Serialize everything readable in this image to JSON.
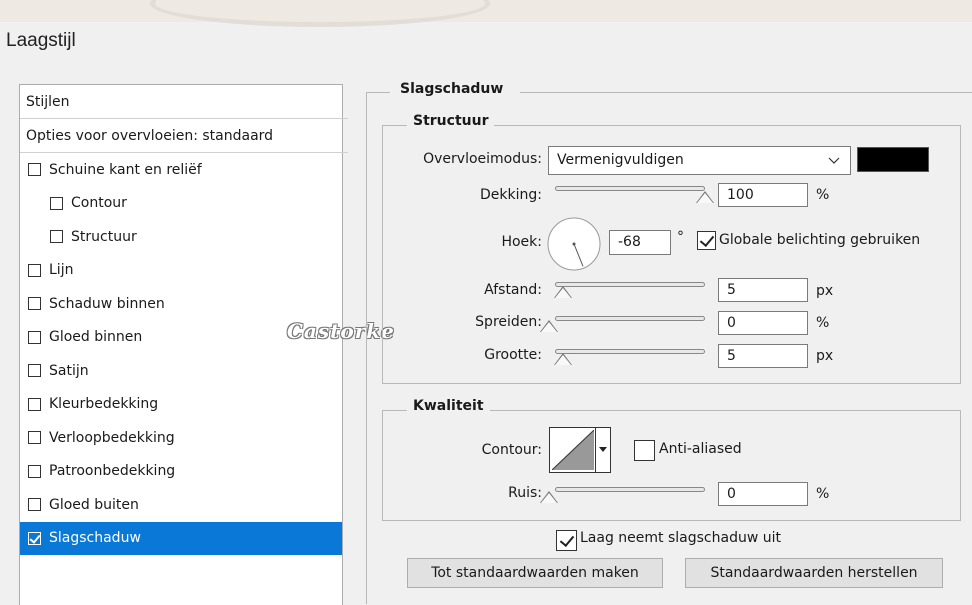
{
  "dialog": {
    "title": "Laagstijl"
  },
  "watermark": "Castorke",
  "styles_panel": {
    "header": "Stijlen",
    "blend_options": "Opties voor overvloeien: standaard",
    "items": [
      {
        "label": "Schuine kant en reliëf",
        "checked": false,
        "indent": false
      },
      {
        "label": "Contour",
        "checked": false,
        "indent": true
      },
      {
        "label": "Structuur",
        "checked": false,
        "indent": true
      },
      {
        "label": "Lijn",
        "checked": false,
        "indent": false
      },
      {
        "label": "Schaduw binnen",
        "checked": false,
        "indent": false
      },
      {
        "label": "Gloed binnen",
        "checked": false,
        "indent": false
      },
      {
        "label": "Satijn",
        "checked": false,
        "indent": false
      },
      {
        "label": "Kleurbedekking",
        "checked": false,
        "indent": false
      },
      {
        "label": "Verloopbedekking",
        "checked": false,
        "indent": false
      },
      {
        "label": "Patroonbedekking",
        "checked": false,
        "indent": false
      },
      {
        "label": "Gloed buiten",
        "checked": false,
        "indent": false
      },
      {
        "label": "Slagschaduw",
        "checked": true,
        "indent": false,
        "selected": true
      }
    ]
  },
  "drop_shadow": {
    "title": "Slagschaduw",
    "structure": {
      "title": "Structuur",
      "blend_mode_label": "Overvloeimodus:",
      "blend_mode_value": "Vermenigvuldigen",
      "color": "#000000",
      "opacity_label": "Dekking:",
      "opacity_value": "100",
      "opacity_unit": "%",
      "opacity_fraction": 1.0,
      "angle_label": "Hoek:",
      "angle_value": "-68",
      "angle_unit": "°",
      "global_light_label": "Globale belichting gebruiken",
      "global_light_checked": true,
      "distance_label": "Afstand:",
      "distance_value": "5",
      "distance_unit": "px",
      "spread_label": "Spreiden:",
      "spread_value": "0",
      "spread_unit": "%",
      "size_label": "Grootte:",
      "size_value": "5",
      "size_unit": "px"
    },
    "quality": {
      "title": "Kwaliteit",
      "contour_label": "Contour:",
      "anti_aliased_label": "Anti-aliased",
      "anti_aliased_checked": false,
      "noise_label": "Ruis:",
      "noise_value": "0",
      "noise_unit": "%"
    },
    "knockout_label": "Laag neemt slagschaduw uit",
    "knockout_checked": true,
    "make_default_label": "Tot standaardwaarden maken",
    "reset_default_label": "Standaardwaarden herstellen"
  }
}
